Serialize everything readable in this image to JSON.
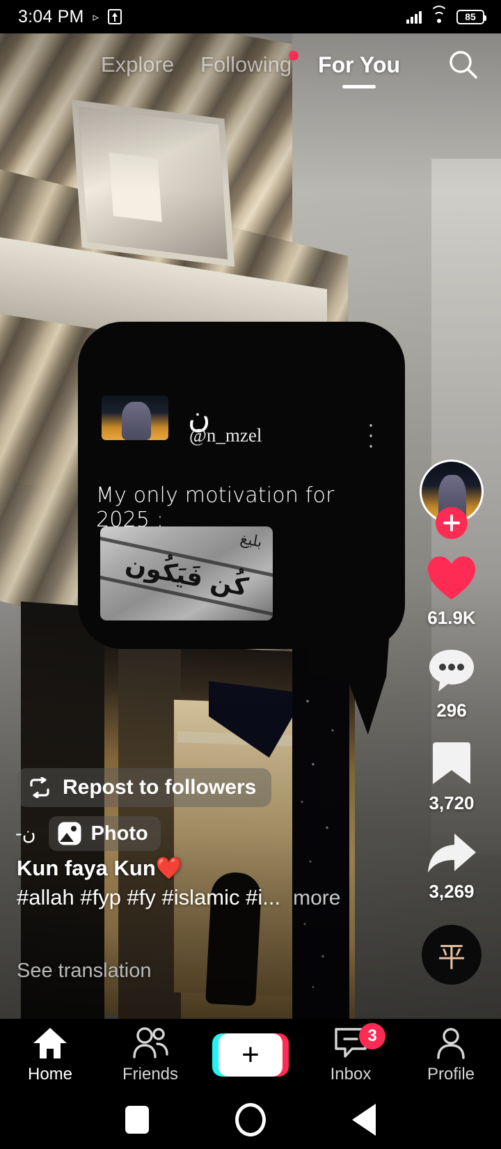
{
  "status_bar": {
    "time": "3:04 PM",
    "play_icon": "play-icon",
    "upload_icon": "upload-icon",
    "signal_icon": "signal-icon",
    "wifi_icon": "wifi-icon",
    "battery_level": "85"
  },
  "top_tabs": {
    "items": [
      {
        "label": "Explore",
        "active": false,
        "has_dot": false
      },
      {
        "label": "Following",
        "active": false,
        "has_dot": true
      },
      {
        "label": "For You",
        "active": true,
        "has_dot": false
      }
    ],
    "search_icon": "search-icon"
  },
  "shared_card": {
    "author_glyph": "ن",
    "handle": "@n_mzel",
    "menu_icon": "more-vertical-icon",
    "text": "My only motivation for 2025 :",
    "image_arabic": "كُن فَيَكُون",
    "image_arabic_top": "بليغ"
  },
  "action_rail": {
    "follow_icon": "plus-icon",
    "like": {
      "icon": "heart-icon",
      "count": "61.9K",
      "liked": true,
      "color": "#fe2c55"
    },
    "comment": {
      "icon": "comment-icon",
      "count": "296"
    },
    "bookmark": {
      "icon": "bookmark-icon",
      "count": "3,720"
    },
    "share": {
      "icon": "share-arrow-icon",
      "count": "3,269"
    },
    "music_disc": {
      "icon": "music-disc-icon",
      "glyph": "平"
    }
  },
  "post_info": {
    "repost_label": "Repost to followers",
    "repost_icon": "repost-icon",
    "username": "-ن",
    "photo_badge_label": "Photo",
    "photo_badge_icon": "photo-icon",
    "caption_title": "Kun faya Kun❤️",
    "caption_tags": "#allah #fyp #fy #islamic #i...",
    "more_label": "more",
    "see_translation_label": "See translation"
  },
  "bottom_nav": {
    "items": [
      {
        "label": "Home",
        "icon": "home-icon",
        "active": true,
        "badge": ""
      },
      {
        "label": "Friends",
        "icon": "friends-icon",
        "active": false,
        "badge": ""
      },
      {
        "label": "",
        "icon": "create-plus-icon",
        "active": false,
        "badge": ""
      },
      {
        "label": "Inbox",
        "icon": "inbox-icon",
        "active": false,
        "badge": "3"
      },
      {
        "label": "Profile",
        "icon": "profile-icon",
        "active": false,
        "badge": ""
      }
    ],
    "create_plus": "+"
  },
  "system_nav": {
    "recents_icon": "square-recents-icon",
    "home_icon": "circle-home-icon",
    "back_icon": "triangle-back-icon"
  },
  "colors": {
    "accent_red": "#fe2c55",
    "accent_cyan": "#25f4ee",
    "background": "#000000"
  }
}
